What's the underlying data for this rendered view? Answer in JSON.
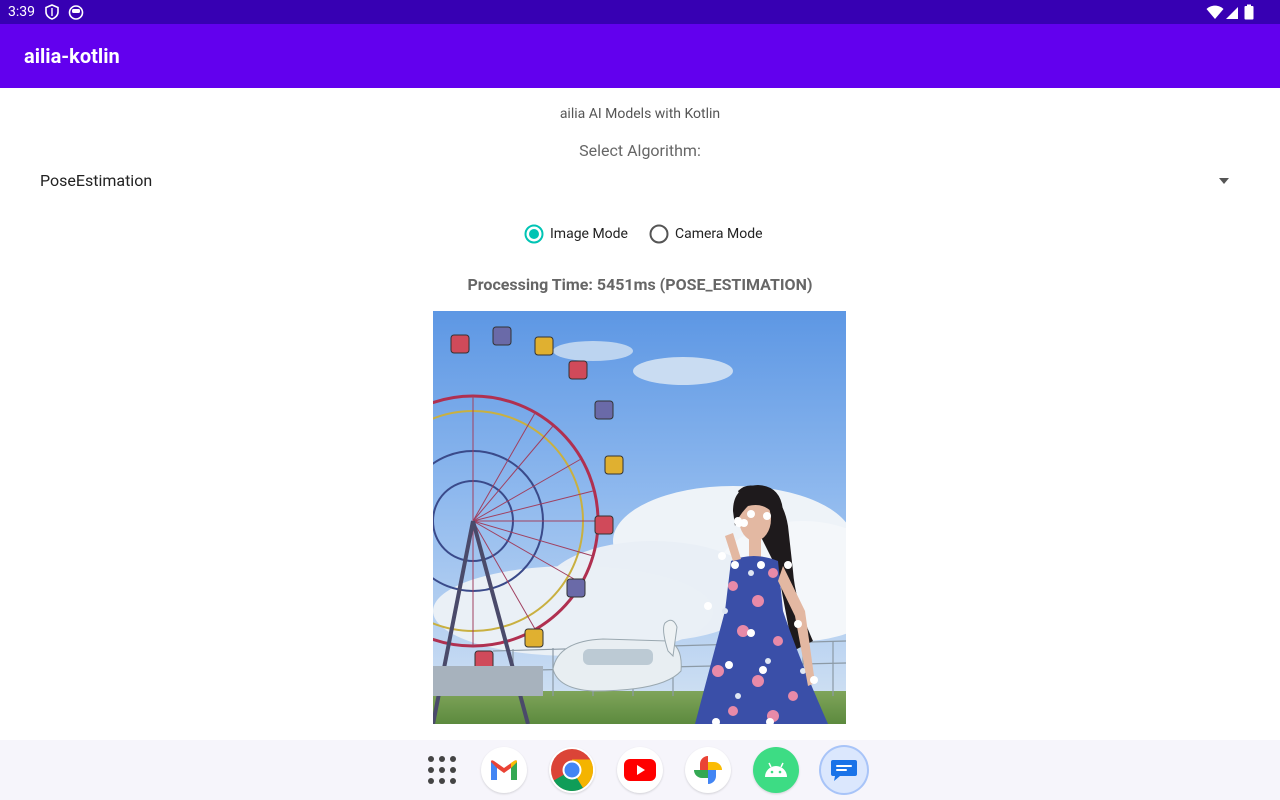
{
  "status_bar": {
    "time": "3:39"
  },
  "app_bar": {
    "title": "ailia-kotlin"
  },
  "main": {
    "subtitle": "ailia AI Models with Kotlin",
    "select_label": "Select Algorithm:",
    "algorithm_selected": "PoseEstimation",
    "modes": [
      {
        "label": "Image Mode",
        "selected": true
      },
      {
        "label": "Camera Mode",
        "selected": false
      }
    ],
    "processing_text": "Processing Time: 5451ms (POSE_ESTIMATION)",
    "accent_color": "#00c4b4"
  },
  "colors": {
    "status_bar": "#3700b3",
    "app_bar": "#6200ee",
    "taskbar": "#f6f5fb"
  },
  "taskbar": {
    "apps": [
      "app-drawer-icon",
      "gmail-icon",
      "chrome-icon",
      "youtube-icon",
      "photos-icon",
      "android-icon",
      "messages-icon"
    ]
  }
}
